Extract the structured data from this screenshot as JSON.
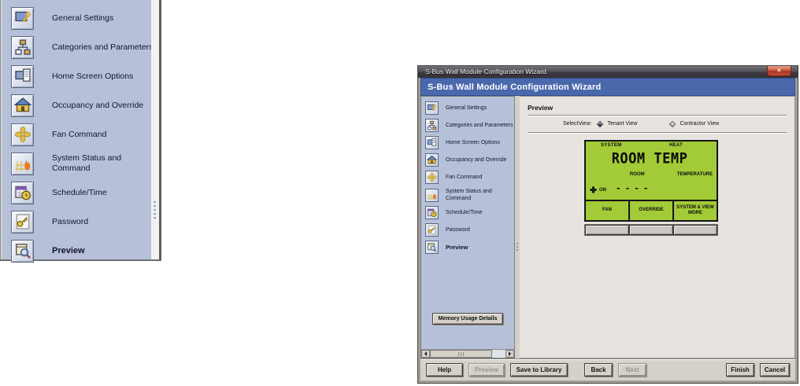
{
  "window": {
    "titlebar_title": "S-Bus Wall Module Configuration Wizard",
    "header_title": "S-Bus Wall Module Configuration Wizard",
    "close_glyph": "×"
  },
  "sidebar": {
    "items": [
      {
        "label": "General Settings",
        "icon": "general-settings-icon"
      },
      {
        "label": "Categories and Parameters",
        "icon": "categories-icon"
      },
      {
        "label": "Home Screen Options",
        "icon": "home-screen-icon"
      },
      {
        "label": "Occupancy and Override",
        "icon": "occupancy-icon"
      },
      {
        "label": "Fan Command",
        "icon": "fan-icon"
      },
      {
        "label": "System Status and Command",
        "icon": "system-status-icon"
      },
      {
        "label": "Schedule/Time",
        "icon": "schedule-icon"
      },
      {
        "label": "Password",
        "icon": "password-icon"
      },
      {
        "label": "Preview",
        "icon": "preview-icon",
        "selected": true
      }
    ],
    "memory_button_label": "Memory Usage Details"
  },
  "preview_panel": {
    "title": "Preview",
    "select_view_label": "SelectView:",
    "view_options": [
      {
        "label": "Tenant View",
        "selected": true
      },
      {
        "label": "Contractor View",
        "selected": false
      }
    ],
    "lcd": {
      "top_left": "SYSTEM",
      "top_right": "HEAT",
      "main_text": "ROOM TEMP",
      "sub_left": "ROOM",
      "sub_right": "TEMPERATURE",
      "dashes": "----",
      "fan_status": "ON",
      "soft_keys": [
        "FAN",
        "OVERRIDE",
        "SYSTEM & VIEW MORE"
      ]
    }
  },
  "footer": {
    "help": "Help",
    "preview": "Preview",
    "save_to_library": "Save to Library",
    "back": "Back",
    "next": "Next",
    "finish": "Finish",
    "cancel": "Cancel"
  },
  "colors": {
    "lcd_green": "#a3cb38",
    "header_blue": "#4a69ad",
    "sidebar_lavender": "#b6c1d9",
    "dialog_gray": "#d5d1c9"
  }
}
